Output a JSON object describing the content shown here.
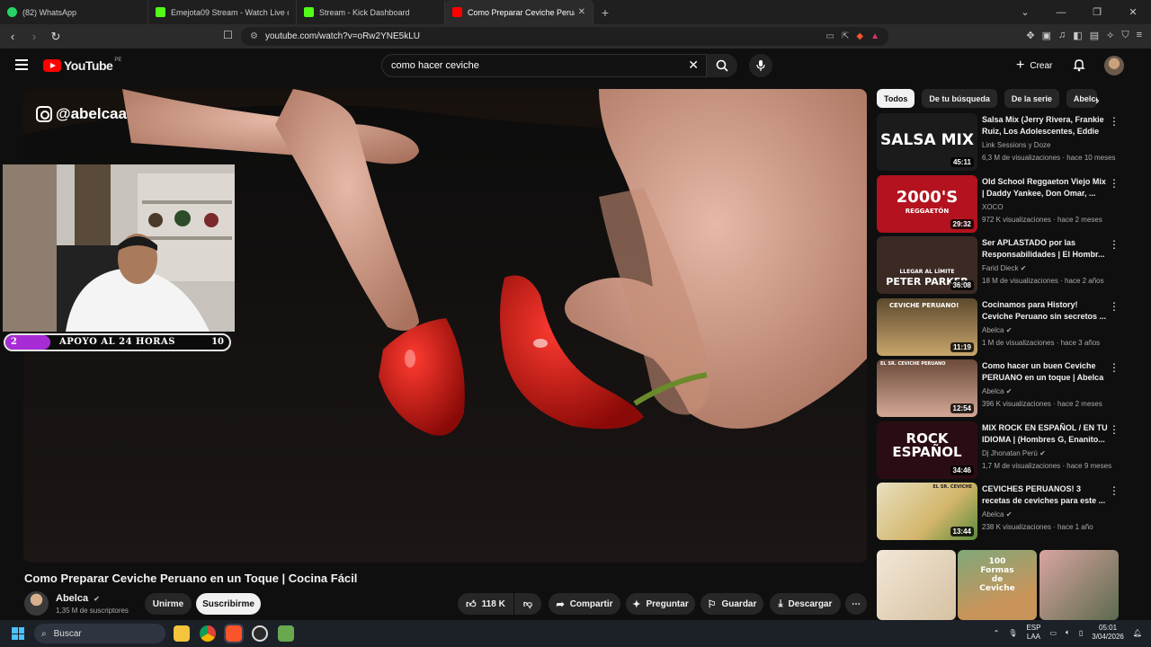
{
  "browser": {
    "tabs": [
      {
        "title": "(82) WhatsApp",
        "favicon_color": "#25d366",
        "active": false
      },
      {
        "title": "Emejota09 Stream - Watch Live o",
        "favicon_color": "#53fc18",
        "active": false
      },
      {
        "title": "Stream - Kick Dashboard",
        "favicon_color": "#53fc18",
        "active": false
      },
      {
        "title": "Como Preparar Ceviche Perua",
        "favicon_color": "#ff0000",
        "active": true
      }
    ],
    "new_tab_icon": "+",
    "url": "youtube.com/watch?v=oRw2YNE5kLU"
  },
  "youtube": {
    "logo_text": "YouTube",
    "country_code": "PE",
    "search_value": "como hacer ceviche",
    "create_label": "Crear",
    "accent": "#ff0000"
  },
  "video": {
    "watermark": "@abelcaa",
    "title": "Como Preparar Ceviche Peruano en un Toque | Cocina Fácil",
    "channel": "Abelca",
    "subscribers": "1,35 M de suscriptores",
    "join_label": "Unirme",
    "subscribe_label": "Suscribirme",
    "likes": "118 K",
    "share_label": "Compartir",
    "ask_label": "Preguntar",
    "save_label": "Guardar",
    "download_label": "Descargar"
  },
  "overlay": {
    "goal_start": "2",
    "goal_label": "APOYO AL 24 HORAS",
    "goal_end": "10",
    "goal_fraction": 0.2,
    "bar_color": "#a82cd6"
  },
  "sidebar": {
    "chips": [
      "Todos",
      "De tu búsqueda",
      "De la serie",
      "Abelca"
    ],
    "recommendations": [
      {
        "title": "Salsa Mix (Jerry Rivera, Frankie Ruiz, Los Adolescentes, Eddie ...",
        "channel": "Link Sessions y Doze",
        "meta": "6,3 M de visualizaciones · hace 10 meses",
        "duration": "45:11",
        "thumb_text": "SALSA MIX",
        "thumb_bg": "#1b1b1b"
      },
      {
        "title": "Old School Reggaeton Viejo Mix | Daddy Yankee, Don Omar, ...",
        "channel": "XOCO",
        "meta": "972 K visualizaciones · hace 2 meses",
        "duration": "29:32",
        "thumb_text": "2000'S",
        "thumb_sub": "REGGAETÓN",
        "thumb_bg": "#b3121e"
      },
      {
        "title": "Ser APLASTADO por las Responsabilidades | El Hombr...",
        "channel": "Farid Dieck",
        "meta": "18 M de visualizaciones · hace 2 años",
        "duration": "36:08",
        "thumb_text": "PETER PARKER",
        "thumb_sub": "LLEGAR AL LÍMITE",
        "thumb_bg": "#3b2a24"
      },
      {
        "title": "Cocinamos para History! Ceviche Peruano sin secretos ...",
        "channel": "Abelca",
        "meta": "1 M de visualizaciones · hace 3 años",
        "duration": "11:19",
        "thumb_text": "CEVICHE PERUANO!",
        "thumb_bg": "#5c4a2e"
      },
      {
        "title": "Como hacer un buen Ceviche PERUANO en un toque | Abelca",
        "channel": "Abelca",
        "meta": "396 K visualizaciones · hace 2 meses",
        "duration": "12:54",
        "thumb_text": "EL SR. CEVICHE PERUANO",
        "thumb_bg": "#6b4a3a"
      },
      {
        "title": "MIX ROCK EN ESPAÑOL / EN TU IDIOMA | (Hombres G, Enanito...",
        "channel": "Dj Jhonatan Perú",
        "meta": "1,7 M de visualizaciones · hace 9 meses",
        "duration": "34:46",
        "thumb_text": "ROCK ESPAÑOL",
        "thumb_bg": "#2a0d12"
      },
      {
        "title": "CEVICHES PERUANOS! 3 recetas de ceviches para este ...",
        "channel": "Abelca",
        "meta": "238 K visualizaciones · hace 1 año",
        "duration": "13:44",
        "thumb_text": "EL SR. CEVICHE",
        "thumb_bg": "#d9cfa6"
      }
    ],
    "shorts_text": "100 Formas de Ceviche"
  },
  "taskbar": {
    "search_placeholder": "Buscar",
    "lang_top": "ESP",
    "lang_bottom": "LAA",
    "time": "05:01",
    "date": "3/04/2026"
  }
}
